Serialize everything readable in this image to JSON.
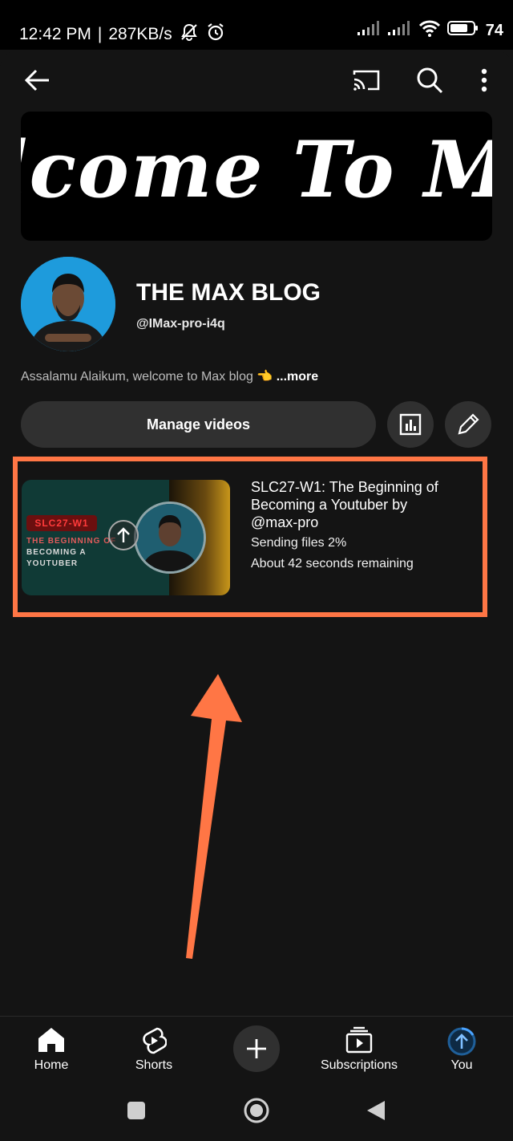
{
  "status_bar": {
    "time": "12:42 PM",
    "separator": "|",
    "speed": "287KB/s",
    "battery": "74"
  },
  "header": {
    "back_icon": "arrow-left-icon",
    "cast_icon": "cast-icon",
    "search_icon": "search-icon",
    "more_icon": "more-vertical-icon"
  },
  "banner": {
    "text": "lcome To My W"
  },
  "channel": {
    "name": "THE MAX BLOG",
    "handle": "@IMax-pro-i4q",
    "description": "Assalamu Alaikum, welcome to Max blog 👈",
    "more_label": "...more"
  },
  "actions": {
    "manage_videos_label": "Manage videos",
    "analytics_icon": "analytics-icon",
    "edit_icon": "pencil-icon"
  },
  "upload": {
    "thumbnail": {
      "tag": "SLC27-W1",
      "line1": "THE BEGINNING OF",
      "line2": "BECOMING A",
      "line3": "YOUTUBER"
    },
    "title": "SLC27-W1: The Beginning of Becoming a Youtuber by @max-pro",
    "status": "Sending files 2%",
    "progress_percent": 2,
    "remaining": "About 42 seconds remaining"
  },
  "annotation": {
    "highlight_color": "#ff7645",
    "arrow_color": "#ff7645"
  },
  "bottom_nav": {
    "items": [
      {
        "label": "Home",
        "icon": "home-icon"
      },
      {
        "label": "Shorts",
        "icon": "shorts-icon"
      },
      {
        "label": "",
        "icon": "plus-icon"
      },
      {
        "label": "Subscriptions",
        "icon": "subscriptions-icon"
      },
      {
        "label": "You",
        "icon": "upload-progress-icon"
      }
    ]
  },
  "system_nav": {
    "recents_icon": "square-icon",
    "home_icon": "circle-icon",
    "back_icon": "triangle-back-icon"
  }
}
